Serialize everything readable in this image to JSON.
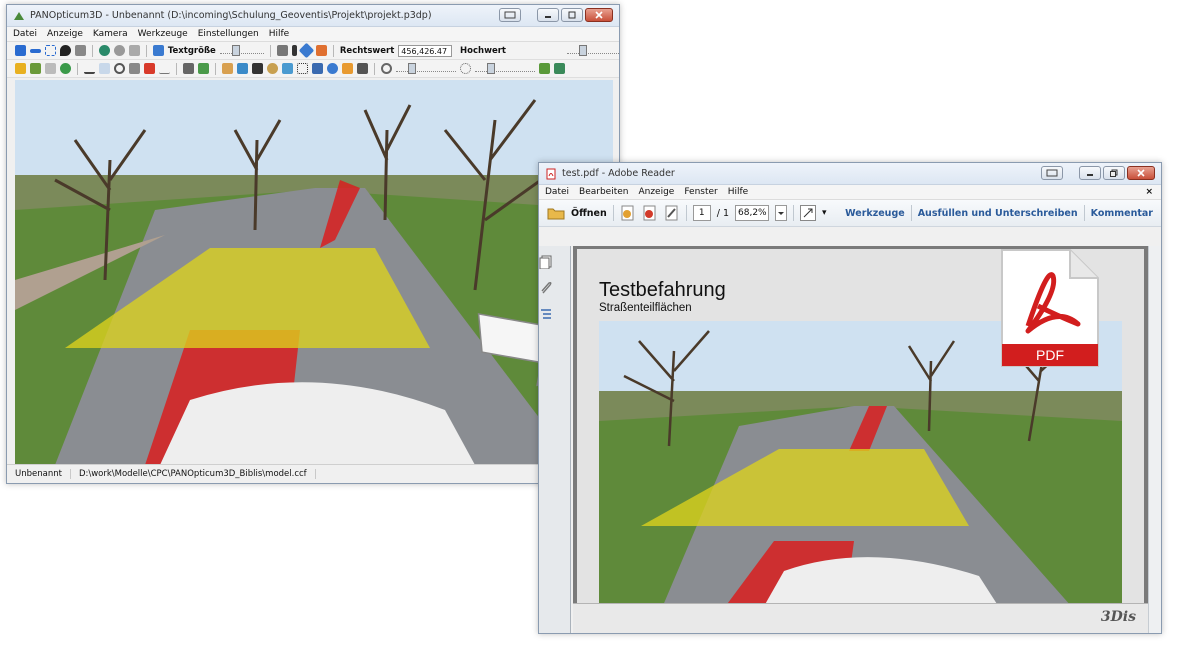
{
  "pano": {
    "title": "PANOpticum3D - Unbenannt (D:\\incoming\\Schulung_Geoventis\\Projekt\\projekt.p3dp)",
    "menu": [
      "Datei",
      "Anzeige",
      "Kamera",
      "Werkzeuge",
      "Einstellungen",
      "Hilfe"
    ],
    "textsize_label": "Textgröße",
    "rechtswert_label": "Rechtswert",
    "rechtswert_value": "456,426.47",
    "hochwert_label": "Hochwert",
    "status_name": "Unbenannt",
    "status_path": "D:\\work\\Modelle\\CPC\\PANOpticum3D_Biblis\\model.ccf"
  },
  "reader": {
    "title": "test.pdf - Adobe Reader",
    "menu": [
      "Datei",
      "Bearbeiten",
      "Anzeige",
      "Fenster",
      "Hilfe"
    ],
    "open_label": "Öffnen",
    "page_current": "1",
    "page_total": "/ 1",
    "zoom": "68,2%",
    "links": [
      "Werkzeuge",
      "Ausfüllen und Unterschreiben",
      "Kommentar"
    ],
    "close_x": "×"
  },
  "document": {
    "heading": "Testbefahrung",
    "subheading": "Straßenteilflächen"
  },
  "pdf_icon_label": "PDF",
  "logo_text": "3Dis",
  "colors": {
    "yellow_overlay": "#dcd21e",
    "red_overlay": "#d81e1e",
    "pdf_red": "#d21e1e"
  }
}
